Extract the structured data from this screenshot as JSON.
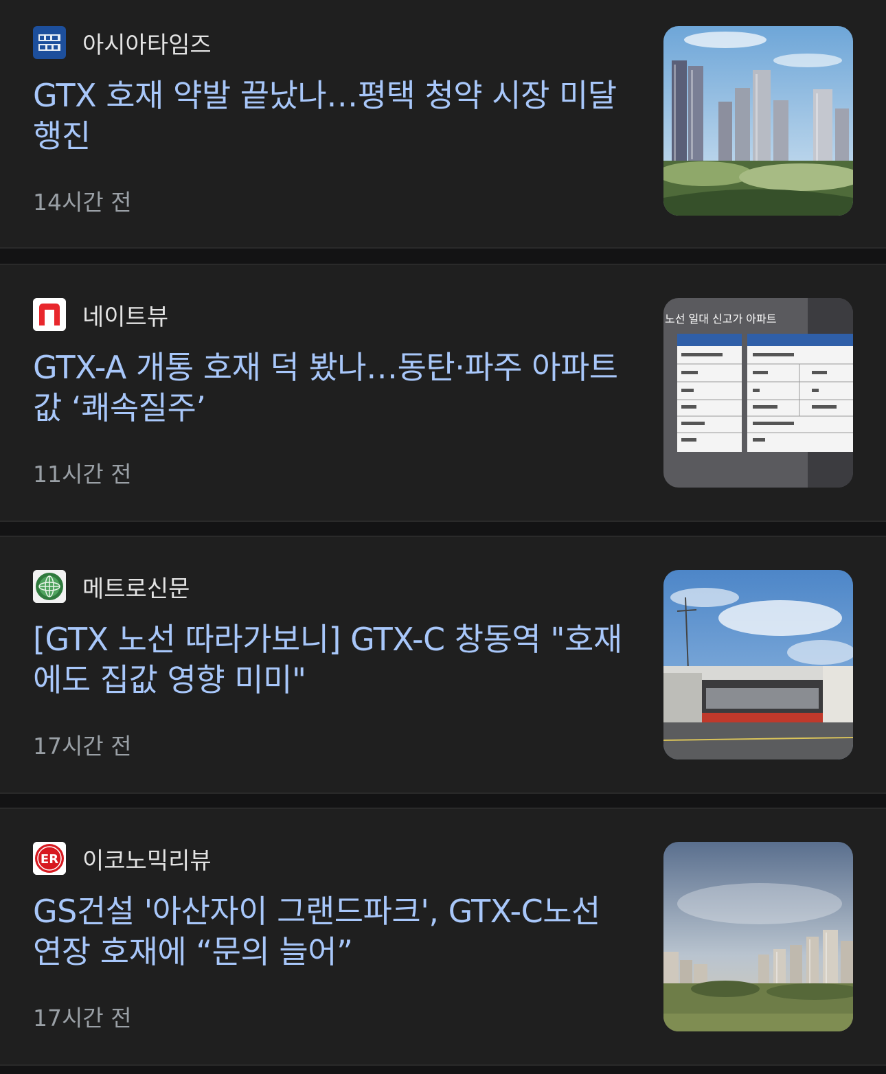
{
  "articles": [
    {
      "source": "아시아타임즈",
      "headline": "GTX 호재 약발 끝났나…평택 청약 시장 미달 행진",
      "time": "14시간 전",
      "logo_icon": "asiatimes-logo-icon",
      "thumbnail": "apartment-complex-photo"
    },
    {
      "source": "네이트뷰",
      "headline": "GTX-A 개통 호재 덕 봤나…동탄·파주 아파트값 ‘쾌속질주’",
      "time": "11시간 전",
      "logo_icon": "nateview-logo-icon",
      "thumbnail": "apartment-table-photo",
      "thumbnail_caption": "노선 일대 신고가 아파트"
    },
    {
      "source": "메트로신문",
      "headline": "[GTX 노선 따라가보니] GTX-C 창동역 \"호재에도 집값 영향 미미\"",
      "time": "17시간 전",
      "logo_icon": "metro-logo-icon",
      "thumbnail": "station-construction-photo"
    },
    {
      "source": "이코노믹리뷰",
      "headline": "GS건설 '아산자이 그랜드파크', GTX-C노선 연장 호재에 “문의 늘어”",
      "time": "17시간 전",
      "logo_icon": "economic-review-logo-icon",
      "logo_text": "ER",
      "thumbnail": "apartment-rendering-photo"
    }
  ],
  "colors": {
    "card_background": "#1f1f1f",
    "page_background": "#131314",
    "headline": "#a8c7fa",
    "source": "#e3e3e3",
    "time": "#9aa0a6",
    "nate_red": "#e8272c",
    "er_red": "#d71920",
    "asia_blue": "#1d4f9c"
  }
}
